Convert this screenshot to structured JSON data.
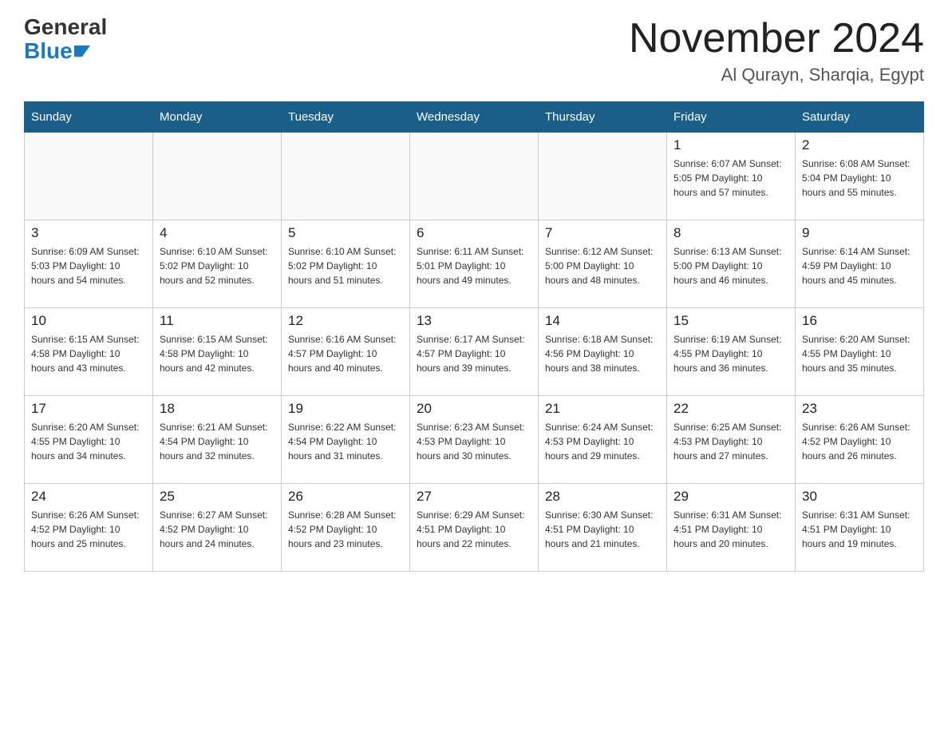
{
  "header": {
    "logo_general": "General",
    "logo_blue": "Blue",
    "month_title": "November 2024",
    "location": "Al Qurayn, Sharqia, Egypt"
  },
  "days_of_week": [
    "Sunday",
    "Monday",
    "Tuesday",
    "Wednesday",
    "Thursday",
    "Friday",
    "Saturday"
  ],
  "weeks": [
    [
      {
        "day": "",
        "detail": ""
      },
      {
        "day": "",
        "detail": ""
      },
      {
        "day": "",
        "detail": ""
      },
      {
        "day": "",
        "detail": ""
      },
      {
        "day": "",
        "detail": ""
      },
      {
        "day": "1",
        "detail": "Sunrise: 6:07 AM\nSunset: 5:05 PM\nDaylight: 10 hours and 57 minutes."
      },
      {
        "day": "2",
        "detail": "Sunrise: 6:08 AM\nSunset: 5:04 PM\nDaylight: 10 hours and 55 minutes."
      }
    ],
    [
      {
        "day": "3",
        "detail": "Sunrise: 6:09 AM\nSunset: 5:03 PM\nDaylight: 10 hours and 54 minutes."
      },
      {
        "day": "4",
        "detail": "Sunrise: 6:10 AM\nSunset: 5:02 PM\nDaylight: 10 hours and 52 minutes."
      },
      {
        "day": "5",
        "detail": "Sunrise: 6:10 AM\nSunset: 5:02 PM\nDaylight: 10 hours and 51 minutes."
      },
      {
        "day": "6",
        "detail": "Sunrise: 6:11 AM\nSunset: 5:01 PM\nDaylight: 10 hours and 49 minutes."
      },
      {
        "day": "7",
        "detail": "Sunrise: 6:12 AM\nSunset: 5:00 PM\nDaylight: 10 hours and 48 minutes."
      },
      {
        "day": "8",
        "detail": "Sunrise: 6:13 AM\nSunset: 5:00 PM\nDaylight: 10 hours and 46 minutes."
      },
      {
        "day": "9",
        "detail": "Sunrise: 6:14 AM\nSunset: 4:59 PM\nDaylight: 10 hours and 45 minutes."
      }
    ],
    [
      {
        "day": "10",
        "detail": "Sunrise: 6:15 AM\nSunset: 4:58 PM\nDaylight: 10 hours and 43 minutes."
      },
      {
        "day": "11",
        "detail": "Sunrise: 6:15 AM\nSunset: 4:58 PM\nDaylight: 10 hours and 42 minutes."
      },
      {
        "day": "12",
        "detail": "Sunrise: 6:16 AM\nSunset: 4:57 PM\nDaylight: 10 hours and 40 minutes."
      },
      {
        "day": "13",
        "detail": "Sunrise: 6:17 AM\nSunset: 4:57 PM\nDaylight: 10 hours and 39 minutes."
      },
      {
        "day": "14",
        "detail": "Sunrise: 6:18 AM\nSunset: 4:56 PM\nDaylight: 10 hours and 38 minutes."
      },
      {
        "day": "15",
        "detail": "Sunrise: 6:19 AM\nSunset: 4:55 PM\nDaylight: 10 hours and 36 minutes."
      },
      {
        "day": "16",
        "detail": "Sunrise: 6:20 AM\nSunset: 4:55 PM\nDaylight: 10 hours and 35 minutes."
      }
    ],
    [
      {
        "day": "17",
        "detail": "Sunrise: 6:20 AM\nSunset: 4:55 PM\nDaylight: 10 hours and 34 minutes."
      },
      {
        "day": "18",
        "detail": "Sunrise: 6:21 AM\nSunset: 4:54 PM\nDaylight: 10 hours and 32 minutes."
      },
      {
        "day": "19",
        "detail": "Sunrise: 6:22 AM\nSunset: 4:54 PM\nDaylight: 10 hours and 31 minutes."
      },
      {
        "day": "20",
        "detail": "Sunrise: 6:23 AM\nSunset: 4:53 PM\nDaylight: 10 hours and 30 minutes."
      },
      {
        "day": "21",
        "detail": "Sunrise: 6:24 AM\nSunset: 4:53 PM\nDaylight: 10 hours and 29 minutes."
      },
      {
        "day": "22",
        "detail": "Sunrise: 6:25 AM\nSunset: 4:53 PM\nDaylight: 10 hours and 27 minutes."
      },
      {
        "day": "23",
        "detail": "Sunrise: 6:26 AM\nSunset: 4:52 PM\nDaylight: 10 hours and 26 minutes."
      }
    ],
    [
      {
        "day": "24",
        "detail": "Sunrise: 6:26 AM\nSunset: 4:52 PM\nDaylight: 10 hours and 25 minutes."
      },
      {
        "day": "25",
        "detail": "Sunrise: 6:27 AM\nSunset: 4:52 PM\nDaylight: 10 hours and 24 minutes."
      },
      {
        "day": "26",
        "detail": "Sunrise: 6:28 AM\nSunset: 4:52 PM\nDaylight: 10 hours and 23 minutes."
      },
      {
        "day": "27",
        "detail": "Sunrise: 6:29 AM\nSunset: 4:51 PM\nDaylight: 10 hours and 22 minutes."
      },
      {
        "day": "28",
        "detail": "Sunrise: 6:30 AM\nSunset: 4:51 PM\nDaylight: 10 hours and 21 minutes."
      },
      {
        "day": "29",
        "detail": "Sunrise: 6:31 AM\nSunset: 4:51 PM\nDaylight: 10 hours and 20 minutes."
      },
      {
        "day": "30",
        "detail": "Sunrise: 6:31 AM\nSunset: 4:51 PM\nDaylight: 10 hours and 19 minutes."
      }
    ]
  ]
}
